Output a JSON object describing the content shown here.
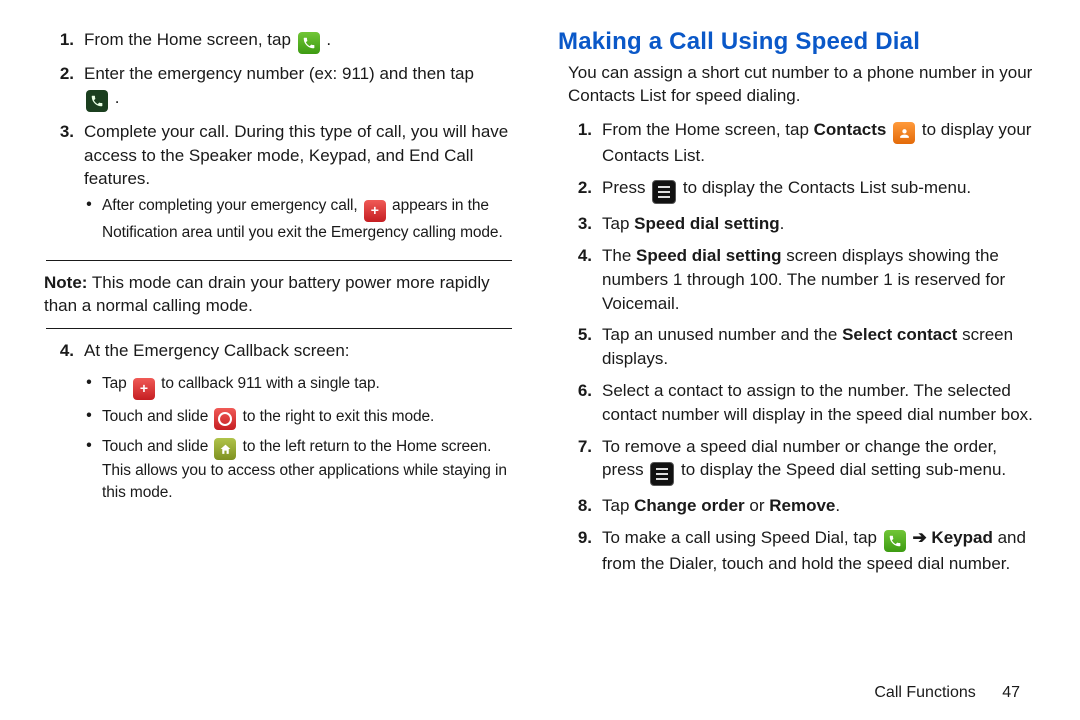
{
  "left": {
    "step1": {
      "num": "1.",
      "text_a": "From the Home screen, tap ",
      "text_b": " ."
    },
    "step2": {
      "num": "2.",
      "text_a": "Enter the emergency number (ex: 911) and then tap ",
      "text_b": "."
    },
    "step3": {
      "num": "3.",
      "text": "Complete your call. During this type of call, you will have access to the Speaker mode, Keypad, and End Call features."
    },
    "step3_sub": {
      "a": "After completing your emergency call, ",
      "b": " appears in the Notification area until you exit the Emergency calling mode."
    },
    "note": {
      "label": "Note:",
      "text": " This mode can drain your battery power more rapidly than a normal calling mode."
    },
    "step4": {
      "num": "4.",
      "text": "At the Emergency Callback screen:"
    },
    "b1": {
      "a": "Tap ",
      "b": " to callback 911 with a single tap."
    },
    "b2": {
      "a": "Touch and slide ",
      "b": " to the right to exit this mode."
    },
    "b3": {
      "a": "Touch and slide ",
      "b": " to the left return to the Home screen. This allows you to access other applications while staying in this mode."
    }
  },
  "right": {
    "heading": "Making a Call Using Speed Dial",
    "intro": "You can assign a short cut number to a phone number in your Contacts List for speed dialing.",
    "s1": {
      "num": "1.",
      "a": "From the Home screen, tap ",
      "b": "Contacts",
      "c": " ",
      "d": " to display your Contacts List."
    },
    "s2": {
      "num": "2.",
      "a": "Press ",
      "b": " to display the Contacts List sub-menu."
    },
    "s3": {
      "num": "3.",
      "a": "Tap ",
      "b": "Speed dial setting",
      "c": "."
    },
    "s4": {
      "num": "4.",
      "a": "The ",
      "b": "Speed dial setting",
      "c": " screen displays showing the numbers 1 through 100. The number 1 is reserved for Voicemail."
    },
    "s5": {
      "num": "5.",
      "a": "Tap an unused number and the ",
      "b": "Select contact",
      "c": " screen displays."
    },
    "s6": {
      "num": "6.",
      "a": "Select a contact to assign to the number. The selected contact number will display in the speed dial number box."
    },
    "s7": {
      "num": "7.",
      "a": "To remove a speed dial number or change the order, press ",
      "b": " to display the Speed dial setting sub-menu."
    },
    "s8": {
      "num": "8.",
      "a": "Tap ",
      "b": "Change order",
      "c": " or ",
      "d": "Remove",
      "e": "."
    },
    "s9": {
      "num": "9.",
      "a": "To make a call using Speed Dial, tap ",
      "arrow": " ➔ ",
      "kp": "Keypad",
      "b": " and from the Dialer, touch and hold the speed dial number."
    }
  },
  "footer": {
    "section": "Call Functions",
    "page": "47"
  }
}
